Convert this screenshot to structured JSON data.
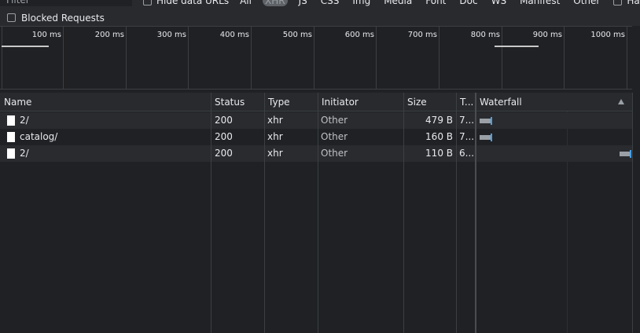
{
  "toolbar": {
    "filter_placeholder": "Filter",
    "hide_data_urls_label": "Hide data URLs",
    "type_filters": [
      "All",
      "XHR",
      "JS",
      "CSS",
      "Img",
      "Media",
      "Font",
      "Doc",
      "WS",
      "Manifest",
      "Other"
    ],
    "active_type": "XHR",
    "has_blocked_cookies_label": "Has blocked cookies",
    "blocked_requests_label": "Blocked Requests"
  },
  "overview": {
    "ticks": [
      "100 ms",
      "200 ms",
      "300 ms",
      "400 ms",
      "500 ms",
      "600 ms",
      "700 ms",
      "800 ms",
      "900 ms",
      "1000 ms"
    ]
  },
  "table": {
    "columns": {
      "name": "Name",
      "status": "Status",
      "type": "Type",
      "initiator": "Initiator",
      "size": "Size",
      "time": "T...",
      "waterfall": "Waterfall"
    },
    "rows": [
      {
        "name": "2/",
        "status": "200",
        "type": "xhr",
        "initiator": "Other",
        "size": "479 B",
        "time": "7..."
      },
      {
        "name": "catalog/",
        "status": "200",
        "type": "xhr",
        "initiator": "Other",
        "size": "160 B",
        "time": "7..."
      },
      {
        "name": "2/",
        "status": "200",
        "type": "xhr",
        "initiator": "Other",
        "size": "110 B",
        "time": "6..."
      }
    ]
  },
  "colors": {
    "background": "#202124",
    "toolbar": "#292a2d",
    "waterfall_waiting": "#9aa0a6",
    "waterfall_download": "#4a9fe8"
  }
}
